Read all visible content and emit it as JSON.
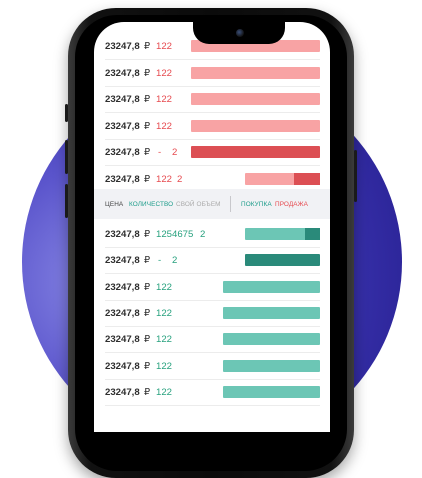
{
  "currency": "₽",
  "sell_rows": [
    {
      "price": "23247,8",
      "volume": "122",
      "count": "",
      "bar": "pink",
      "fill": 0.6
    },
    {
      "price": "23247,8",
      "volume": "122",
      "count": "",
      "bar": "pink",
      "fill": 0.6
    },
    {
      "price": "23247,8",
      "volume": "122",
      "count": "",
      "bar": "pink",
      "fill": 0.6
    },
    {
      "price": "23247,8",
      "volume": "122",
      "count": "",
      "bar": "pink",
      "fill": 0.6
    },
    {
      "price": "23247,8",
      "volume": "-",
      "count": "2",
      "bar": "red",
      "fill": 0.6
    },
    {
      "price": "23247,8",
      "volume": "122",
      "count": "2",
      "bar": "split",
      "fill": 0.35,
      "split_fill": 0.35
    }
  ],
  "header": {
    "price": "ЦЕНА",
    "quantity": "КОЛИЧЕСТВО",
    "own_volume": "СВОЙ ОБЪЕМ",
    "buy": "ПОКУПКА",
    "sell": "ПРОДАЖА"
  },
  "buy_rows": [
    {
      "price": "23247,8",
      "volume": "1254675",
      "count": "2",
      "bar": "split",
      "fill": 0.35,
      "split_fill": 0.2
    },
    {
      "price": "23247,8",
      "volume": "-",
      "count": "2",
      "bar": "dteal",
      "fill": 0.35
    },
    {
      "price": "23247,8",
      "volume": "122",
      "count": "",
      "bar": "teal",
      "fill": 0.45
    },
    {
      "price": "23247,8",
      "volume": "122",
      "count": "",
      "bar": "teal",
      "fill": 0.45
    },
    {
      "price": "23247,8",
      "volume": "122",
      "count": "",
      "bar": "teal",
      "fill": 0.45
    },
    {
      "price": "23247,8",
      "volume": "122",
      "count": "",
      "bar": "teal",
      "fill": 0.45
    },
    {
      "price": "23247,8",
      "volume": "122",
      "count": "",
      "bar": "teal",
      "fill": 0.45
    }
  ],
  "colors": {
    "sell_text": "#e64a4f",
    "buy_text": "#27a17e",
    "bar_pink": "#f8a3a4",
    "bar_red": "#dc4f54",
    "bar_teal": "#6cc6b5",
    "bar_dark_teal": "#2a8a7a",
    "circle_dark": "#221b8a",
    "circle_light": "#8b8be6"
  }
}
